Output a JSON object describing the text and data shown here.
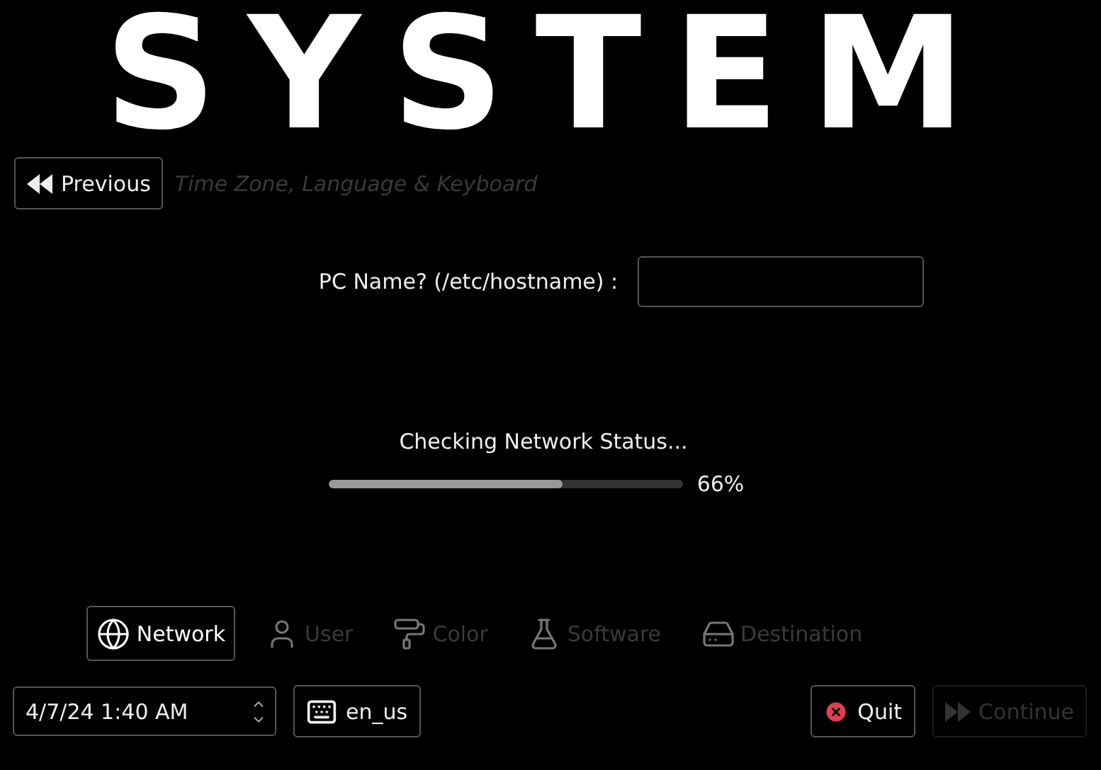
{
  "logo": "SYSTEM",
  "previous": {
    "label": "Previous",
    "section": "Time Zone, Language & Keyboard"
  },
  "hostname": {
    "label": "PC Name? (/etc/hostname) :"
  },
  "progress": {
    "status": "Checking Network Status...",
    "level": 0.66,
    "reading": "66%"
  },
  "steps": [
    {
      "kind": "network",
      "label": "Network",
      "selected": true
    },
    {
      "kind": "user",
      "label": "User",
      "selected": false
    },
    {
      "kind": "color",
      "label": "Color",
      "selected": false
    },
    {
      "kind": "software",
      "label": "Software",
      "selected": false
    },
    {
      "kind": "destination",
      "label": "Destination",
      "selected": false
    }
  ],
  "datetime": "4/7/24 1:40 AM",
  "keyboard": "en_us",
  "quit": "Quit",
  "continue": {
    "label": "Continue",
    "disabled": true
  }
}
